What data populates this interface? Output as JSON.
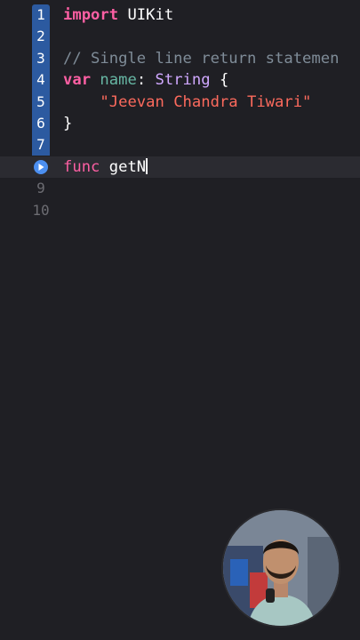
{
  "editor": {
    "lines": [
      {
        "number": "1",
        "tokens": [
          {
            "text": "import",
            "cls": "kw"
          },
          {
            "text": " UIKit",
            "cls": "pl"
          }
        ]
      },
      {
        "number": "2",
        "tokens": []
      },
      {
        "number": "3",
        "tokens": [
          {
            "text": "// Single line return statemen",
            "cls": "cm"
          }
        ]
      },
      {
        "number": "4",
        "tokens": [
          {
            "text": "var",
            "cls": "kw"
          },
          {
            "text": " ",
            "cls": "pl"
          },
          {
            "text": "name",
            "cls": "id"
          },
          {
            "text": ": ",
            "cls": "pl"
          },
          {
            "text": "String",
            "cls": "ty"
          },
          {
            "text": " {",
            "cls": "pl"
          }
        ]
      },
      {
        "number": "5",
        "tokens": [
          {
            "text": "    ",
            "cls": "pl"
          },
          {
            "text": "\"Jeevan Chandra Tiwari\"",
            "cls": "st"
          }
        ]
      },
      {
        "number": "6",
        "tokens": [
          {
            "text": "}",
            "cls": "pl"
          }
        ]
      },
      {
        "number": "7",
        "tokens": []
      },
      {
        "number": "",
        "tokens": [
          {
            "text": "func",
            "cls": "kw-light"
          },
          {
            "text": " getN",
            "cls": "pl"
          }
        ],
        "current": true,
        "breakpoint": true
      },
      {
        "number": "9",
        "tokens": [],
        "dim": true
      },
      {
        "number": "10",
        "tokens": [],
        "dim": true
      }
    ]
  },
  "colors": {
    "background": "#1f1f24",
    "gutter_highlight": "#2c5aa0",
    "keyword": "#fc5fa3",
    "comment": "#7f8c98",
    "type": "#d0a8ff",
    "identifier": "#67b7a4",
    "string": "#fc6a5d"
  },
  "icons": {
    "breakpoint": "play-arrow-icon",
    "webcam": "presenter-webcam"
  }
}
